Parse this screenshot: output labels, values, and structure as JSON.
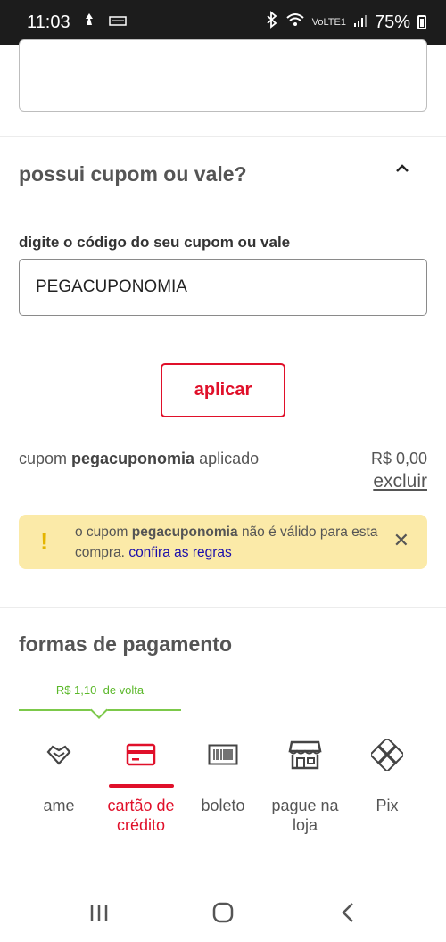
{
  "status_bar": {
    "time": "11:03",
    "network": "VoLTE1",
    "battery": "75%"
  },
  "coupon": {
    "title": "possui cupom ou vale?",
    "field_label": "digite o código do seu cupom ou vale",
    "code_value": "PEGACUPONOMIA",
    "apply_label": "aplicar",
    "applied_prefix": "cupom",
    "applied_code": "pegacuponomia",
    "applied_suffix": "aplicado",
    "applied_value": "R$ 0,00",
    "remove_label": "excluir",
    "warning": {
      "prefix": "o cupom",
      "code": "pegacuponomia",
      "suffix": "não é válido para esta compra.",
      "link": "confira as regras"
    }
  },
  "payment": {
    "title": "formas de pagamento",
    "cashback_amount": "R$ 1,10",
    "cashback_label": "de volta",
    "options": [
      {
        "label": "ame",
        "icon": "ame-heart-icon"
      },
      {
        "label": "cartão de crédito",
        "icon": "credit-card-icon"
      },
      {
        "label": "boleto",
        "icon": "barcode-icon"
      },
      {
        "label": "pague na loja",
        "icon": "store-icon"
      },
      {
        "label": "Pix",
        "icon": "pix-icon"
      }
    ],
    "selected": "cartão de crédito"
  },
  "colors": {
    "accent": "#e0102a",
    "cashback": "#5bb82a",
    "warning_bg": "#fbeaa8",
    "warning_icon": "#e4b400"
  }
}
